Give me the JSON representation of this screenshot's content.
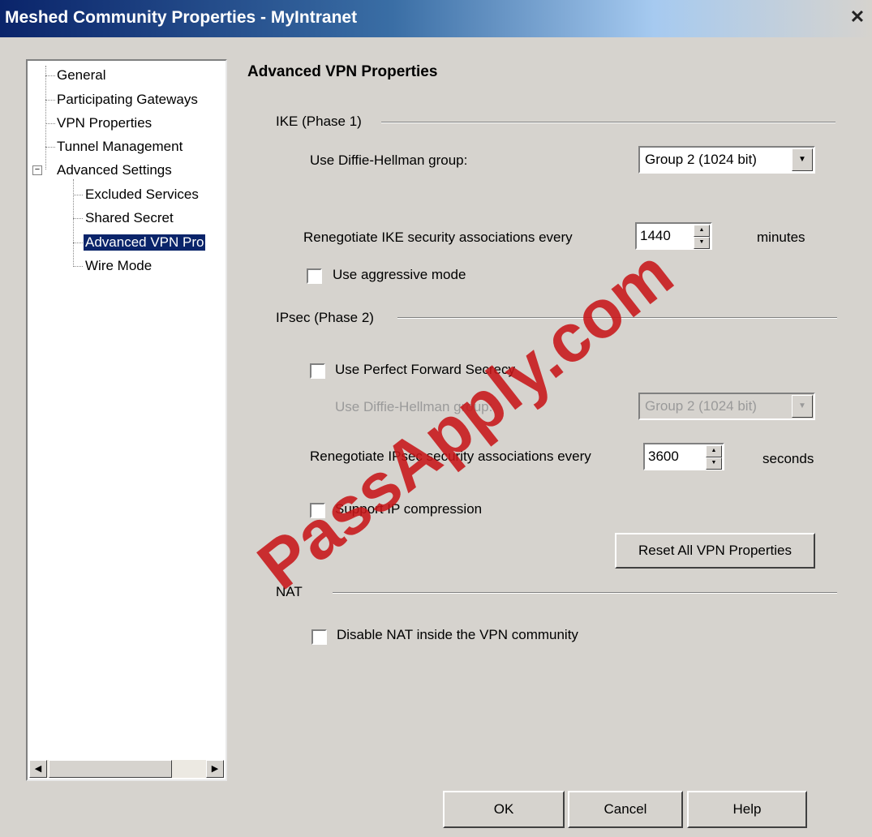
{
  "window": {
    "title": "Meshed Community Properties - MyIntranet",
    "close_glyph": "✕"
  },
  "tree": {
    "items": [
      {
        "label": "General"
      },
      {
        "label": "Participating Gateways"
      },
      {
        "label": "VPN Properties"
      },
      {
        "label": "Tunnel Management"
      },
      {
        "label": "Advanced Settings",
        "expander": "−"
      },
      {
        "label": "Excluded Services"
      },
      {
        "label": "Shared Secret"
      },
      {
        "label": "Advanced VPN Pro",
        "selected": true
      },
      {
        "label": "Wire Mode"
      }
    ],
    "scroll_left": "◀",
    "scroll_right": "▶"
  },
  "panel": {
    "heading": "Advanced VPN Properties",
    "ike": {
      "group_label": "IKE (Phase 1)",
      "dh_label": "Use Diffie-Hellman group:",
      "dh_value": "Group 2 (1024 bit)",
      "renegotiate_label": "Renegotiate IKE security associations every",
      "renegotiate_value": "1440",
      "renegotiate_unit": "minutes",
      "aggressive_label": "Use aggressive mode",
      "aggressive_checked": false
    },
    "ipsec": {
      "group_label": "IPsec (Phase 2)",
      "pfs_label": "Use Perfect Forward Secrecy",
      "pfs_checked": false,
      "pfs_dh_label": "Use Diffie-Hellman group:",
      "pfs_dh_value": "Group 2 (1024 bit)",
      "renegotiate_label": "Renegotiate IPsec security associations every",
      "renegotiate_value": "3600",
      "renegotiate_unit": "seconds",
      "compression_label": "Support IP compression",
      "compression_checked": false,
      "reset_button": "Reset All VPN Properties"
    },
    "nat": {
      "group_label": "NAT",
      "disable_label": "Disable NAT inside the VPN community",
      "disable_checked": false
    }
  },
  "footer": {
    "ok": "OK",
    "cancel": "Cancel",
    "help": "Help"
  },
  "watermark": "PassApply.com",
  "colors": {
    "selection": "#0a246a",
    "watermark": "#c8171a",
    "dialog_bg": "#d6d3ce"
  },
  "icons": {
    "dropdown": "▼",
    "spin_up": "▲",
    "spin_down": "▼"
  }
}
